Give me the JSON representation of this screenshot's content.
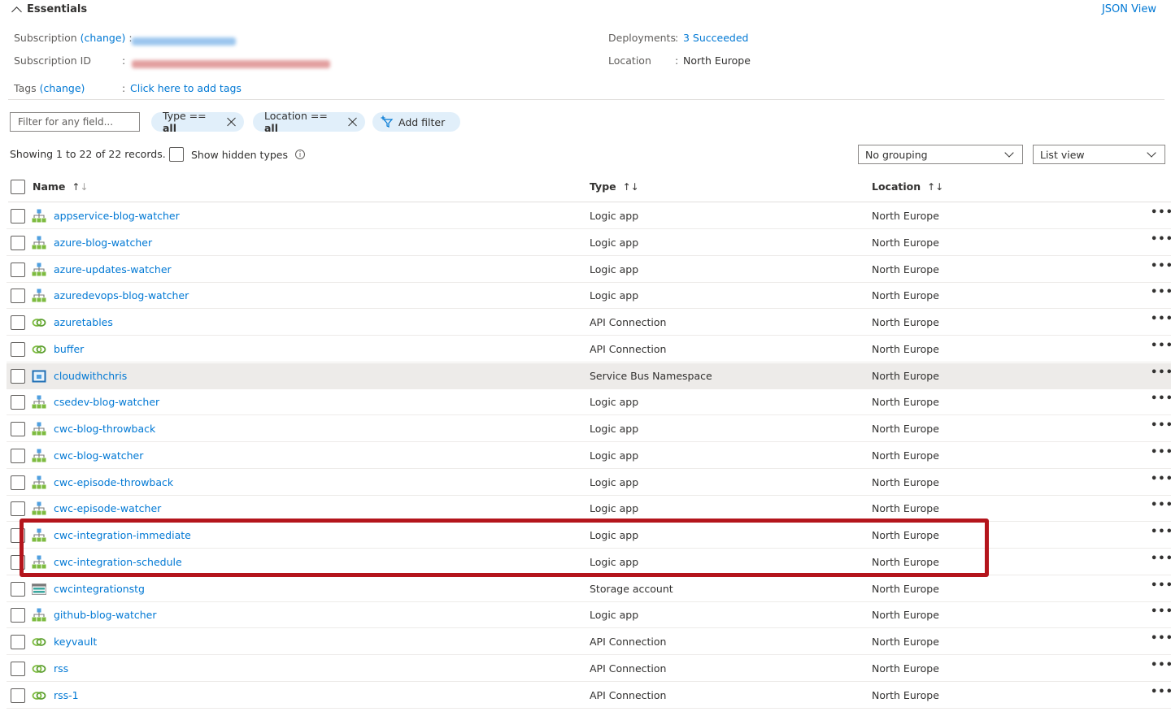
{
  "essentials": {
    "title": "Essentials",
    "json_view": "JSON View",
    "subscription_label": "Subscription",
    "subscription_change": "(change)",
    "subscription_id_label": "Subscription ID",
    "tags_label": "Tags",
    "tags_change": "(change)",
    "tags_value": "Click here to add tags",
    "deployments_label": "Deployments",
    "deployments_value": "3 Succeeded",
    "location_label": "Location",
    "location_value": "North Europe",
    "colon": ":"
  },
  "filters": {
    "placeholder": "Filter for any field...",
    "type_prefix": "Type ==",
    "type_value": "all",
    "location_prefix": "Location ==",
    "location_value": "all",
    "add_filter": "Add filter"
  },
  "summary": {
    "showing": "Showing 1 to 22 of 22 records.",
    "show_hidden": "Show hidden types",
    "grouping": "No grouping",
    "view": "List view"
  },
  "columns": {
    "name": "Name",
    "type": "Type",
    "location": "Location"
  },
  "rows": [
    {
      "name": "appservice-blog-watcher",
      "type": "Logic app",
      "location": "North Europe",
      "icon": "logic-app"
    },
    {
      "name": "azure-blog-watcher",
      "type": "Logic app",
      "location": "North Europe",
      "icon": "logic-app"
    },
    {
      "name": "azure-updates-watcher",
      "type": "Logic app",
      "location": "North Europe",
      "icon": "logic-app"
    },
    {
      "name": "azuredevops-blog-watcher",
      "type": "Logic app",
      "location": "North Europe",
      "icon": "logic-app"
    },
    {
      "name": "azuretables",
      "type": "API Connection",
      "location": "North Europe",
      "icon": "api-connection"
    },
    {
      "name": "buffer",
      "type": "API Connection",
      "location": "North Europe",
      "icon": "api-connection"
    },
    {
      "name": "cloudwithchris",
      "type": "Service Bus Namespace",
      "location": "North Europe",
      "icon": "service-bus"
    },
    {
      "name": "csedev-blog-watcher",
      "type": "Logic app",
      "location": "North Europe",
      "icon": "logic-app"
    },
    {
      "name": "cwc-blog-throwback",
      "type": "Logic app",
      "location": "North Europe",
      "icon": "logic-app"
    },
    {
      "name": "cwc-blog-watcher",
      "type": "Logic app",
      "location": "North Europe",
      "icon": "logic-app"
    },
    {
      "name": "cwc-episode-throwback",
      "type": "Logic app",
      "location": "North Europe",
      "icon": "logic-app"
    },
    {
      "name": "cwc-episode-watcher",
      "type": "Logic app",
      "location": "North Europe",
      "icon": "logic-app"
    },
    {
      "name": "cwc-integration-immediate",
      "type": "Logic app",
      "location": "North Europe",
      "icon": "logic-app"
    },
    {
      "name": "cwc-integration-schedule",
      "type": "Logic app",
      "location": "North Europe",
      "icon": "logic-app"
    },
    {
      "name": "cwcintegrationstg",
      "type": "Storage account",
      "location": "North Europe",
      "icon": "storage"
    },
    {
      "name": "github-blog-watcher",
      "type": "Logic app",
      "location": "North Europe",
      "icon": "logic-app"
    },
    {
      "name": "keyvault",
      "type": "API Connection",
      "location": "North Europe",
      "icon": "api-connection"
    },
    {
      "name": "rss",
      "type": "API Connection",
      "location": "North Europe",
      "icon": "api-connection"
    },
    {
      "name": "rss-1",
      "type": "API Connection",
      "location": "North Europe",
      "icon": "api-connection"
    }
  ],
  "highlighted_row_index": 6,
  "more_glyph": "•••",
  "colors": {
    "link": "#0078d4",
    "annotation_box": "#b4151c",
    "pill_bg": "#e1effa",
    "hover_row": "#edebe9"
  }
}
